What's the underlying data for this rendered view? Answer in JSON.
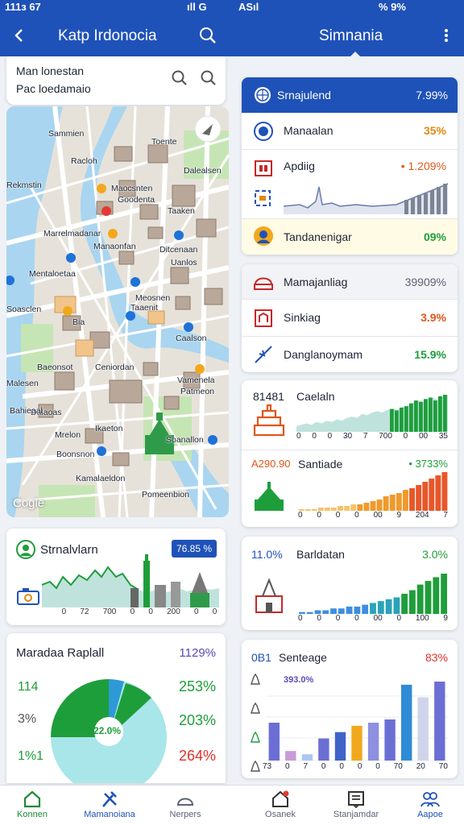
{
  "status_bar": {
    "left_time": "111з 67",
    "left_right": "ıll G",
    "right_left": "ASıl",
    "right_right": "% 9%"
  },
  "header": {
    "left_title": "Katp Irdonocia",
    "right_title": "Simnania"
  },
  "search": {
    "line1": "Man lonestan",
    "line2": "Pac loedamaio"
  },
  "map": {
    "watermark": "Cogle",
    "labels": [
      "Sammien",
      "Toente",
      "Racloh",
      "Dalealsen",
      "Maocsnten",
      "Goodenta",
      "Rekmstin",
      "Taaken",
      "Manaonfan",
      "Mentaloetaa",
      "Ditcenaan",
      "Marrelmadanar",
      "Uanlos",
      "Meosnen",
      "Soasclen",
      "Taaenit",
      "Bia",
      "Caalson",
      "Baeonsot",
      "Ceniordan",
      "Malesen",
      "Vamenela",
      "Patmeon",
      "Dalaoas",
      "Ikaeton",
      "Mrelon",
      "Soanallon",
      "Bahieaal",
      "Kamalaeldon",
      "Boonsnon",
      "Pomeenbion"
    ]
  },
  "left_chart_card": {
    "title": "Strnalvlarn",
    "badge": "76.85 %",
    "ticks": [
      "0",
      "72",
      "700",
      "0",
      "0",
      "200",
      "0",
      "0"
    ]
  },
  "left_pie_card": {
    "title": "Maradaa Raplall",
    "value_top": "1129%",
    "left_labels": [
      "114",
      "3%",
      "1%1"
    ],
    "right_values": [
      "253%",
      "203%",
      "264%"
    ],
    "center_label": "22.0%",
    "colors": {
      "green": "#1e9e3a",
      "light": "#a9e6ea",
      "blue": "#2d9ad6"
    }
  },
  "right_list_card1": {
    "header": {
      "label": "Srnajulend",
      "value": "7.99%"
    },
    "rows": [
      {
        "label": "Manaalan",
        "value": "35%",
        "color": "#e08a12"
      },
      {
        "label": "Apdiig",
        "value": "• 1.209%",
        "color": "#e0561b"
      },
      {
        "label": "Tandanenigar",
        "value": "09%",
        "color": "#1e9e3a"
      }
    ]
  },
  "right_list_card2": {
    "rows": [
      {
        "label": "Mamajanliag",
        "value": "39909%",
        "color": "#5b6375"
      },
      {
        "label": "Sinkiag",
        "value": "3.9%",
        "color": "#e0561b"
      },
      {
        "label": "Danglanoymam",
        "value": "15.9%",
        "color": "#1e9e3a"
      }
    ]
  },
  "chart_data": [
    {
      "type": "bar",
      "title": "Caelaln",
      "value_label": "81481",
      "ticks": [
        "0",
        "0",
        "0",
        "30",
        "7",
        "700",
        "0",
        "00",
        "35"
      ],
      "values": [
        3,
        4,
        5,
        4,
        6,
        5,
        7,
        6,
        8,
        7,
        9,
        10,
        9,
        12,
        11,
        13,
        14,
        13,
        15,
        16,
        15,
        17,
        18,
        20,
        22,
        21,
        23,
        24,
        22,
        25,
        26
      ]
    },
    {
      "type": "bar",
      "title": "Santiade",
      "value_label": "A290.90",
      "trend_label": "• 3733%",
      "ticks": [
        "0",
        "0",
        "0",
        "0",
        "00",
        "9",
        "204",
        "7"
      ],
      "values": [
        1,
        1,
        1,
        2,
        2,
        2,
        3,
        3,
        4,
        4,
        5,
        6,
        7,
        9,
        10,
        11,
        13,
        14,
        16,
        18,
        20,
        22,
        24
      ]
    },
    {
      "type": "bar",
      "title": "Barldatan",
      "value_label": "11.0%",
      "trend_label": "3.0%",
      "ticks": [
        "0",
        "0",
        "0",
        "0",
        "00",
        "0",
        "100",
        "9"
      ],
      "values": [
        1,
        1,
        2,
        2,
        3,
        3,
        4,
        4,
        5,
        6,
        7,
        8,
        9,
        11,
        13,
        16,
        18,
        20,
        22
      ]
    },
    {
      "type": "bar",
      "title": "Senteage",
      "value_label": "0B1",
      "side_value": "83%",
      "inner_label": "393.0%",
      "ticks": [
        "73",
        "0",
        "7",
        "0",
        "0",
        "0",
        "0",
        "70",
        "20",
        "70"
      ],
      "values": [
        12,
        3,
        2,
        7,
        9,
        11,
        12,
        13,
        24,
        20,
        25
      ]
    }
  ],
  "bottom_nav": [
    {
      "label": "Konnen",
      "icon": "home-icon"
    },
    {
      "label": "Mamanoiana",
      "icon": "tools-icon"
    },
    {
      "label": "Nerpers",
      "icon": "helmet-icon"
    },
    {
      "label": "Osanek",
      "icon": "notification-home-icon"
    },
    {
      "label": "Stanjamdar",
      "icon": "document-icon"
    },
    {
      "label": "Aapoe",
      "icon": "people-icon"
    }
  ]
}
